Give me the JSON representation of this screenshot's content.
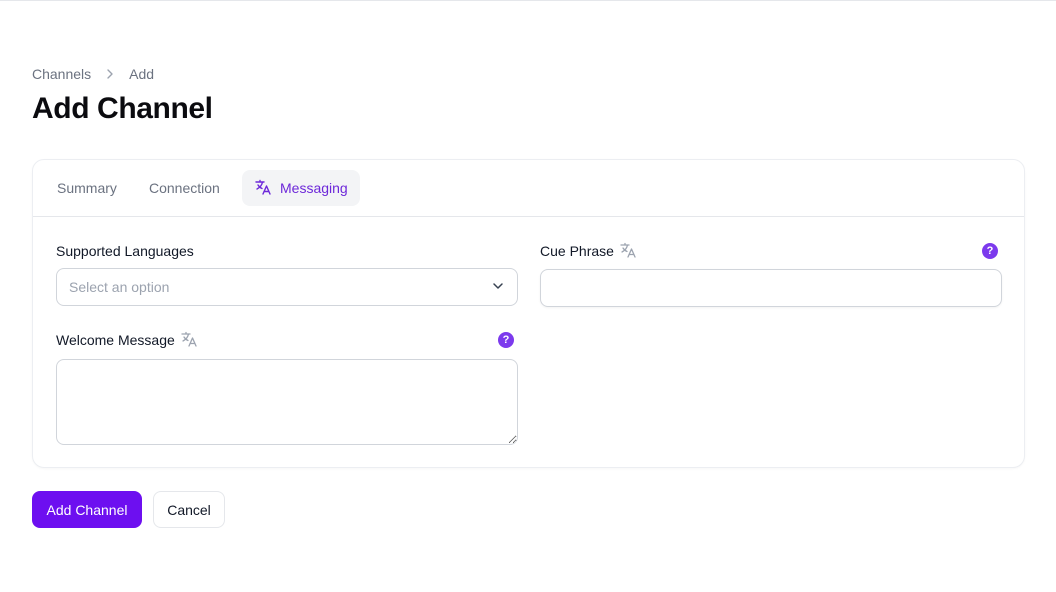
{
  "breadcrumb": {
    "items": [
      "Channels",
      "Add"
    ]
  },
  "page": {
    "title": "Add Channel"
  },
  "tabs": [
    {
      "label": "Summary"
    },
    {
      "label": "Connection"
    },
    {
      "label": "Messaging",
      "icon": "translate-icon",
      "active": true
    }
  ],
  "form": {
    "supported_languages": {
      "label": "Supported Languages",
      "placeholder": "Select an option"
    },
    "cue_phrase": {
      "label": "Cue Phrase",
      "value": "",
      "help": "?"
    },
    "welcome_message": {
      "label": "Welcome Message",
      "value": "",
      "help": "?"
    }
  },
  "actions": {
    "submit_label": "Add Channel",
    "cancel_label": "Cancel"
  },
  "colors": {
    "accent": "#6d0ff0",
    "tab_active": "#6d28d9",
    "help": "#7c3aed"
  }
}
